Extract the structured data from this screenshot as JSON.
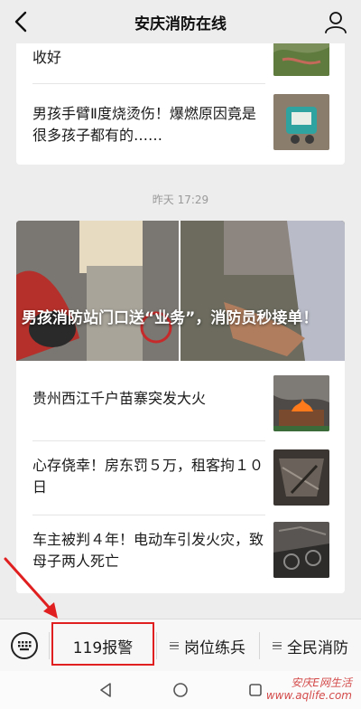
{
  "header": {
    "title": "安庆消防在线",
    "back_icon": "chevron-left-icon",
    "profile_icon": "person-icon"
  },
  "top_card": {
    "items": [
      {
        "title": "收好",
        "thumb": "landscape-thumbnail"
      },
      {
        "title": "男孩手臂Ⅱ度烧烫伤！爆燃原因竟是很多孩子都有的……",
        "thumb": "toy-thumbnail"
      }
    ]
  },
  "timestamp": "昨天 17:29",
  "second_card": {
    "hero_title": "男孩消防站门口送“业务”，消防员秒接单！",
    "items": [
      {
        "title": "贵州西江千户苗寨突发大火",
        "thumb": "fire-thumbnail"
      },
      {
        "title": "心存侥幸！房东罚５万，租客拘１０日",
        "thumb": "burnt-room-thumbnail"
      },
      {
        "title": "车主被判４年！电动车引发火灾，致母子两人死亡",
        "thumb": "burnt-vehicle-thumbnail"
      }
    ]
  },
  "bottom_menu": {
    "keyboard_icon": "keyboard-icon",
    "items": [
      {
        "label": "119报警"
      },
      {
        "label": "岗位练兵"
      },
      {
        "label": "全民消防"
      }
    ]
  },
  "system_nav": {
    "back": "back-triangle-icon",
    "home": "home-circle-icon",
    "recent": "recent-square-icon"
  },
  "watermark": {
    "line1": "安庆E网生活",
    "line2": "www.aqlife.com"
  },
  "colors": {
    "background": "#ededed",
    "card": "#ffffff",
    "highlight": "#e02020",
    "arrow": "#e02020"
  }
}
